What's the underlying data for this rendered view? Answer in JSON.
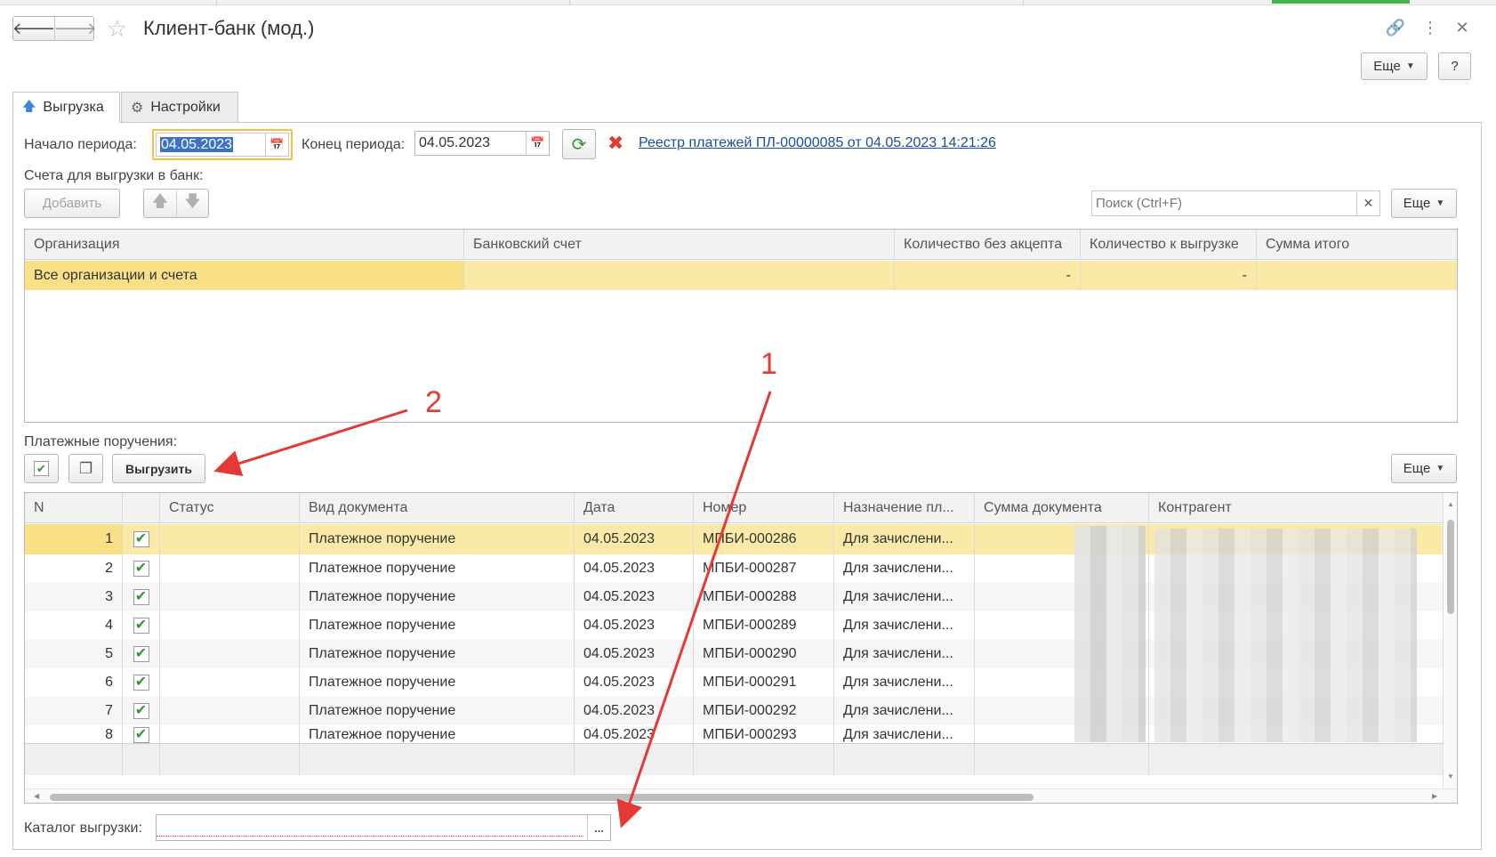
{
  "window": {
    "title": "Клиент-банк (мод.)"
  },
  "toolbar": {
    "more_label": "Еще",
    "help_label": "?"
  },
  "tabs": [
    {
      "label": "Выгрузка"
    },
    {
      "label": "Настройки"
    }
  ],
  "period": {
    "start_label": "Начало периода:",
    "start_value": "04.05.2023",
    "end_label": "Конец периода:",
    "end_value": "04.05.2023",
    "registry_link": "Реестр платежей ПЛ-00000085 от 04.05.2023 14:21:26"
  },
  "accounts": {
    "section_label": "Счета для выгрузки в банк:",
    "add_label": "Добавить",
    "search_placeholder": "Поиск (Ctrl+F)",
    "more_label": "Еще",
    "columns": [
      "Организация",
      "Банковский счет",
      "Количество без акцепта",
      "Количество к выгрузке",
      "Сумма итого"
    ],
    "rows": [
      {
        "org": "Все организации и счета",
        "account": "",
        "no_accept": "-",
        "to_upload": "-",
        "total": ""
      }
    ]
  },
  "orders": {
    "section_label": "Платежные поручения:",
    "upload_label": "Выгрузить",
    "more_label": "Еще",
    "columns": [
      "N",
      "",
      "Статус",
      "Вид документа",
      "Дата",
      "Номер",
      "Назначение пл...",
      "Сумма документа",
      "Контрагент"
    ],
    "rows": [
      {
        "n": "1",
        "status": "",
        "kind": "Платежное поручение",
        "date": "04.05.2023",
        "number": "МПБИ-000286",
        "purpose": "Для зачислени..."
      },
      {
        "n": "2",
        "status": "",
        "kind": "Платежное поручение",
        "date": "04.05.2023",
        "number": "МПБИ-000287",
        "purpose": "Для зачислени..."
      },
      {
        "n": "3",
        "status": "",
        "kind": "Платежное поручение",
        "date": "04.05.2023",
        "number": "МПБИ-000288",
        "purpose": "Для зачислени..."
      },
      {
        "n": "4",
        "status": "",
        "kind": "Платежное поручение",
        "date": "04.05.2023",
        "number": "МПБИ-000289",
        "purpose": "Для зачислени..."
      },
      {
        "n": "5",
        "status": "",
        "kind": "Платежное поручение",
        "date": "04.05.2023",
        "number": "МПБИ-000290",
        "purpose": "Для зачислени..."
      },
      {
        "n": "6",
        "status": "",
        "kind": "Платежное поручение",
        "date": "04.05.2023",
        "number": "МПБИ-000291",
        "purpose": "Для зачислени..."
      },
      {
        "n": "7",
        "status": "",
        "kind": "Платежное поручение",
        "date": "04.05.2023",
        "number": "МПБИ-000292",
        "purpose": "Для зачислени..."
      },
      {
        "n": "8",
        "status": "",
        "kind": "Платежное поручение",
        "date": "04.05.2023",
        "number": "МПБИ-000293",
        "purpose": "Для зачислени..."
      }
    ]
  },
  "catalog": {
    "label": "Каталог выгрузки:",
    "value": "",
    "browse_label": "..."
  },
  "annotations": {
    "one": "1",
    "two": "2"
  },
  "colors": {
    "selected_row": "#fbeaa7",
    "focus_border": "#f6c244",
    "link": "#1a4ea1",
    "annotation": "#e53935",
    "check": "#2e9b2e"
  }
}
